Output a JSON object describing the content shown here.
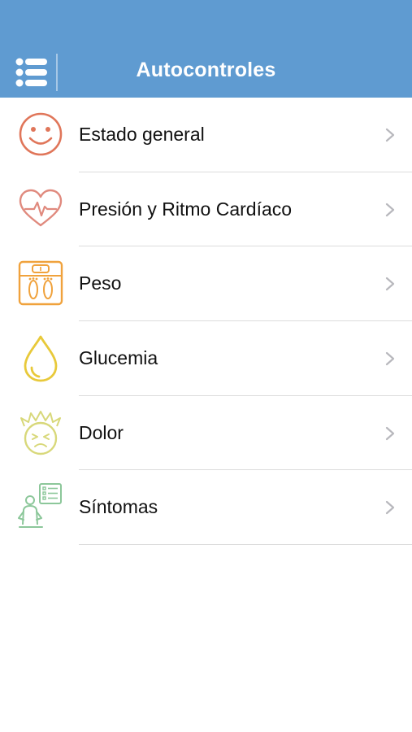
{
  "header": {
    "title": "Autocontroles",
    "background": "#5f9bd1",
    "menu_icon": "hamburger-list-icon"
  },
  "items": [
    {
      "label": "Estado general",
      "icon": "smiley-face-icon",
      "color": "#e0765a"
    },
    {
      "label": "Presión y Ritmo Cardíaco",
      "icon": "heart-pulse-icon",
      "color": "#e08a7e"
    },
    {
      "label": "Peso",
      "icon": "scale-footprints-icon",
      "color": "#f0a23c"
    },
    {
      "label": "Glucemia",
      "icon": "drop-icon",
      "color": "#e8c93a"
    },
    {
      "label": "Dolor",
      "icon": "pain-face-icon",
      "color": "#d8d87a"
    },
    {
      "label": "Síntomas",
      "icon": "person-symptoms-list-icon",
      "color": "#8cc79a"
    }
  ],
  "chevron_icon": "chevron-right-icon"
}
